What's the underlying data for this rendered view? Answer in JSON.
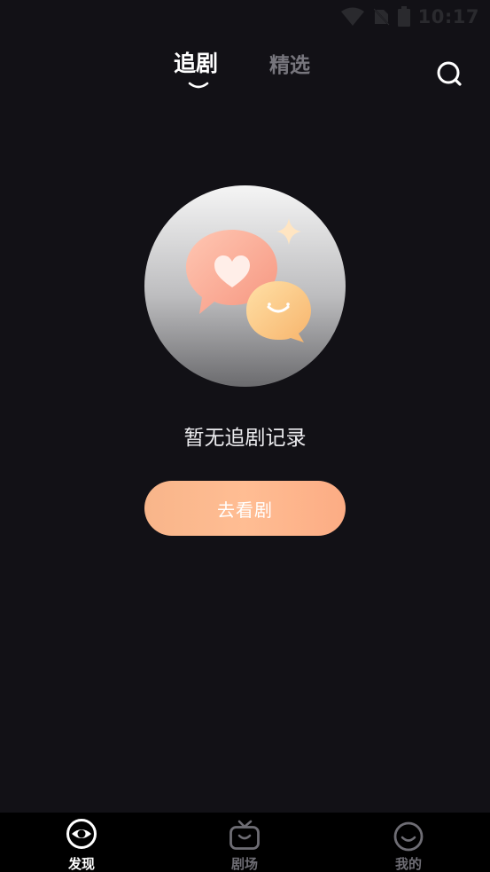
{
  "status_bar": {
    "time": "10:17",
    "icons": [
      "wifi-icon",
      "no-sim-icon",
      "battery-icon"
    ]
  },
  "top_tabs": {
    "active": "追剧",
    "inactive": "精选"
  },
  "empty_state": {
    "message": "暂无追剧记录",
    "button_label": "去看剧"
  },
  "bottom_nav": {
    "items": [
      {
        "label": "发现",
        "icon": "eye-icon",
        "active": true
      },
      {
        "label": "剧场",
        "icon": "tv-icon",
        "active": false
      },
      {
        "label": "我的",
        "icon": "smile-icon",
        "active": false
      }
    ]
  },
  "colors": {
    "background": "#121116",
    "accent": "#f8b58a",
    "nav_background": "#000000",
    "inactive": "#6e6d74"
  }
}
